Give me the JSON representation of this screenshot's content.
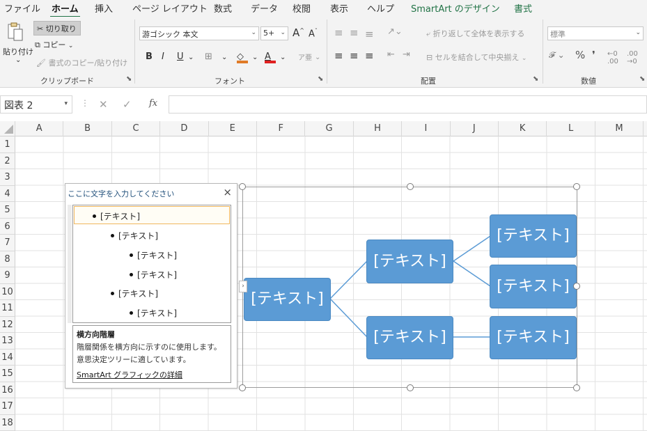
{
  "ribbon_tabs": [
    "ファイル",
    "ホーム",
    "挿入",
    "ページ レイアウト",
    "数式",
    "データ",
    "校閲",
    "表示",
    "ヘルプ",
    "SmartArt のデザイン",
    "書式"
  ],
  "active_tab": "ホーム",
  "clipboard": {
    "paste": "貼り付け",
    "cut": "切り取り",
    "copy": "コピー",
    "format_painter": "書式のコピー/貼り付け",
    "label": "クリップボード"
  },
  "font": {
    "name": "游ゴシック 本文",
    "size": "5+",
    "label": "フォント",
    "bold": "B",
    "italic": "I",
    "underline": "U",
    "grow": "A",
    "shrink": "A"
  },
  "alignment": {
    "wrap_text": "折り返して全体を表示する",
    "merge_center": "セルを結合して中央揃え",
    "label": "配置"
  },
  "number": {
    "format": "標準",
    "label": "数値"
  },
  "formula_bar": {
    "name_box": "図表 2",
    "fx": "fx"
  },
  "columns": [
    "A",
    "B",
    "C",
    "D",
    "E",
    "F",
    "G",
    "H",
    "I",
    "J",
    "K",
    "L",
    "M"
  ],
  "rows": [
    "1",
    "2",
    "3",
    "4",
    "5",
    "6",
    "7",
    "8",
    "9",
    "10",
    "11",
    "12",
    "13",
    "14",
    "15",
    "16",
    "17",
    "18"
  ],
  "text_pane": {
    "title": "ここに文字を入力してください",
    "close": "×",
    "items": [
      {
        "level": 1,
        "text": "[テキスト]"
      },
      {
        "level": 2,
        "text": "[テキスト]"
      },
      {
        "level": 3,
        "text": "[テキスト]"
      },
      {
        "level": 3,
        "text": "[テキスト]"
      },
      {
        "level": 2,
        "text": "[テキスト]"
      },
      {
        "level": 3,
        "text": "[テキスト]"
      }
    ],
    "desc_title": "横方向階層",
    "desc_lines": [
      "階層関係を横方向に示すのに使用します。",
      "意思決定ツリーに適しています。"
    ],
    "link": "SmartArt グラフィックの詳細"
  },
  "smartart": {
    "node_color": "#5b9bd5",
    "connector_color": "#5b9bd5",
    "nodes": [
      "[テキスト]",
      "[テキスト]",
      "[テキスト]",
      "[テキスト]",
      "[テキスト]",
      "[テキスト]"
    ]
  }
}
